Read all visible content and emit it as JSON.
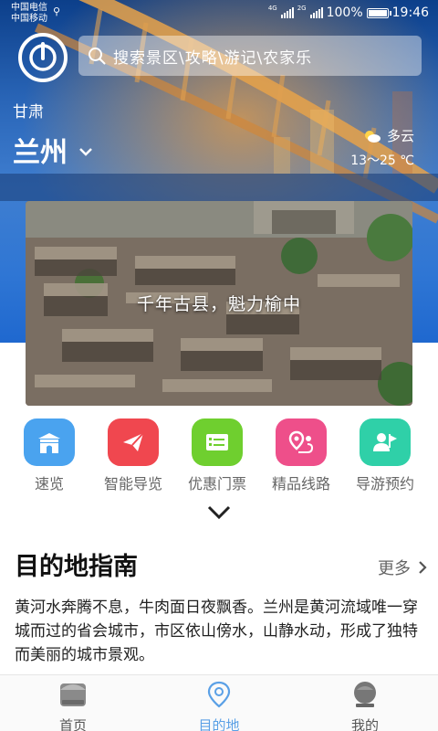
{
  "statusbar": {
    "carrier1": "中国电信",
    "carrier2": "中国移动",
    "battery": "100%",
    "time": "19:46"
  },
  "search": {
    "placeholder": "搜索景区\\攻略\\游记\\农家乐"
  },
  "location": {
    "province": "甘肃",
    "city": "兰州"
  },
  "weather": {
    "condition": "多云",
    "temperature": "13～25 ℃"
  },
  "banner": {
    "caption": "千年古县，魁力榆中"
  },
  "quick_nav": [
    {
      "label": "速览",
      "icon": "gate-icon",
      "color": "#4aa3ef"
    },
    {
      "label": "智能导览",
      "icon": "paper-plane-icon",
      "color": "#f0474f"
    },
    {
      "label": "优惠门票",
      "icon": "ticket-icon",
      "color": "#6fcf2f"
    },
    {
      "label": "精品线路",
      "icon": "route-icon",
      "color": "#ee4f8a"
    },
    {
      "label": "导游预约",
      "icon": "guide-icon",
      "color": "#2fd0a8"
    }
  ],
  "guide": {
    "title": "目的地指南",
    "more": "更多",
    "text": "黄河水奔腾不息，牛肉面日夜飘香。兰州是黄河流域唯一穿城而过的省会城市，市区依山傍水，山静水动，形成了独特而美丽的城市景观。"
  },
  "tabbar": [
    {
      "label": "首页",
      "icon": "home-icon",
      "active": false
    },
    {
      "label": "目的地",
      "icon": "location-pin-icon",
      "active": true
    },
    {
      "label": "我的",
      "icon": "profile-icon",
      "active": false
    }
  ],
  "colors": {
    "accent": "#5aa0e6",
    "hero_blue": "#2a66b8"
  }
}
